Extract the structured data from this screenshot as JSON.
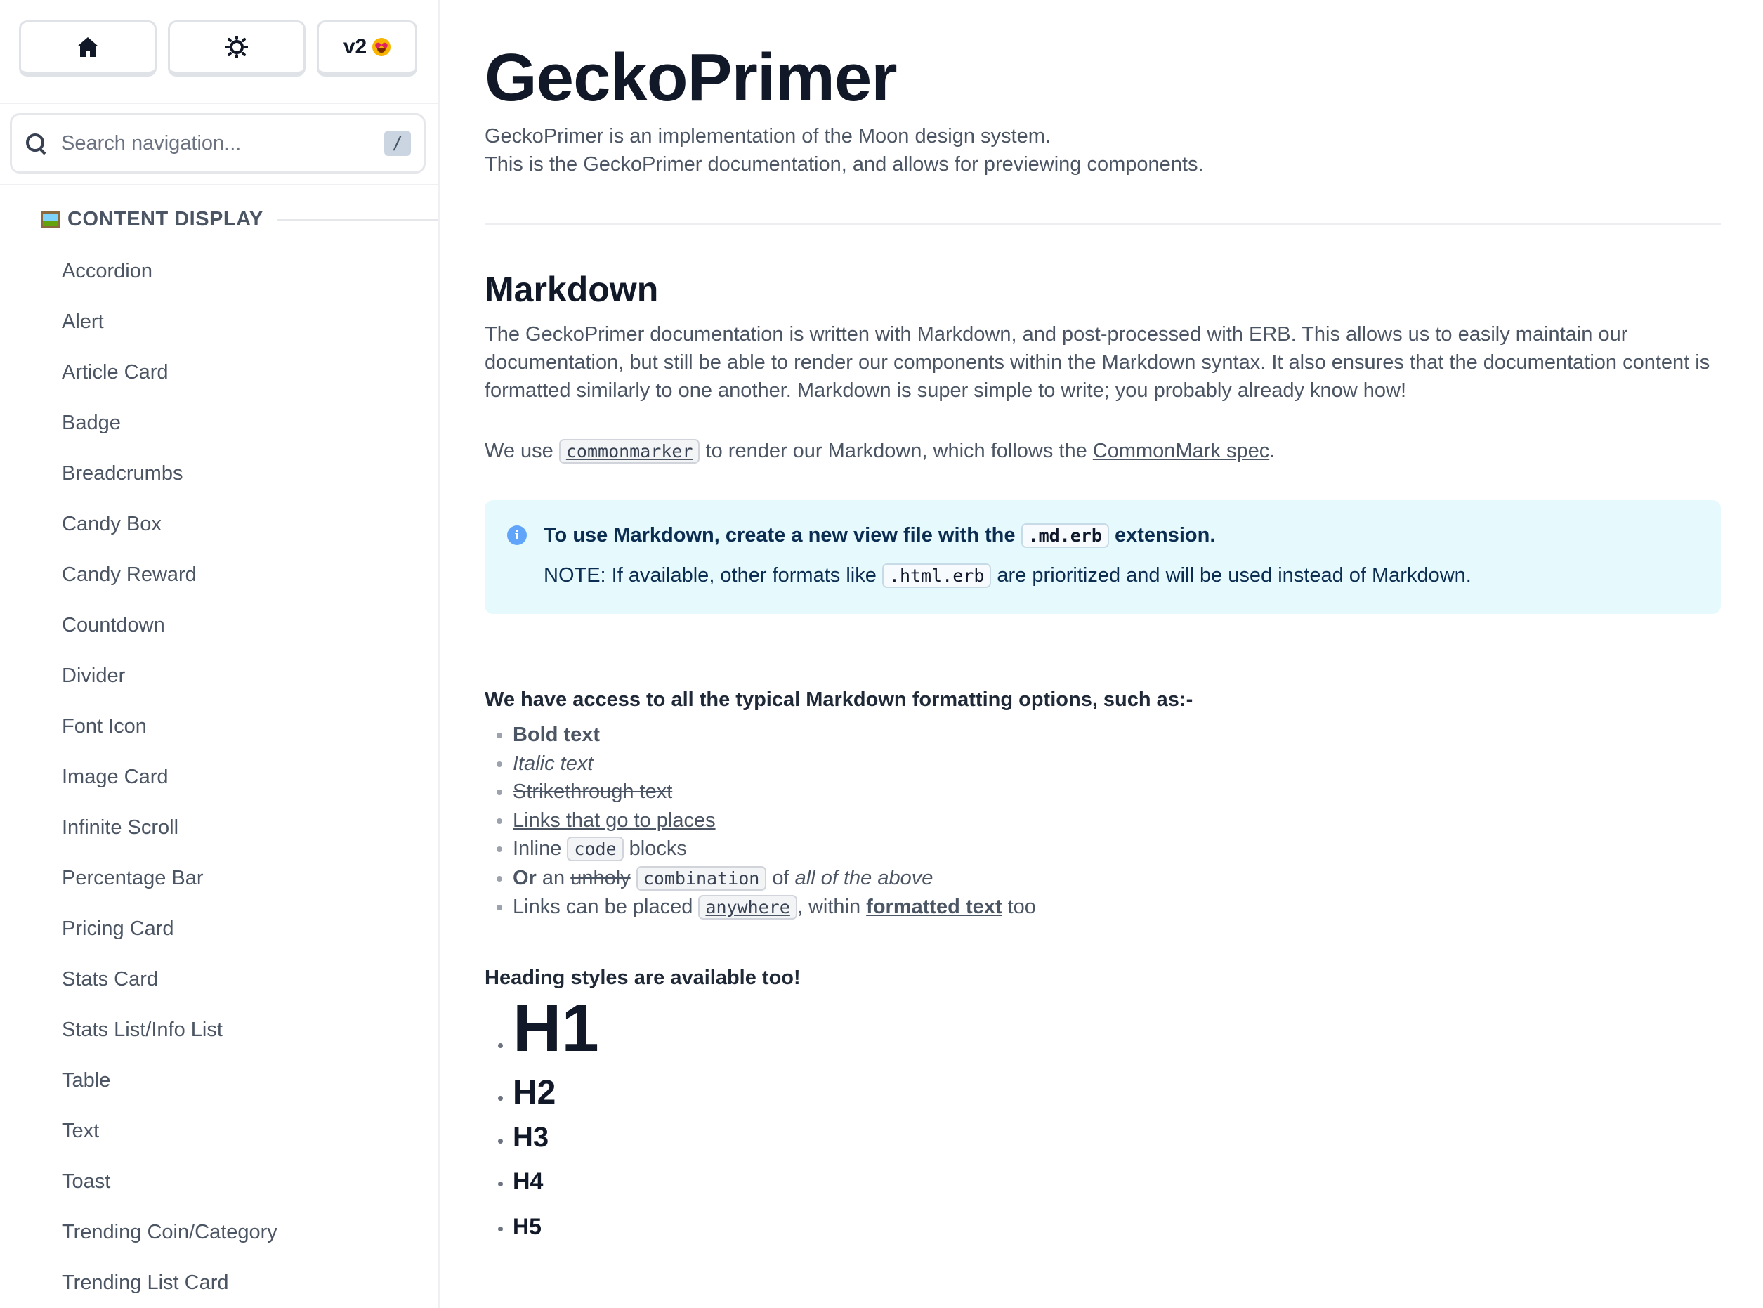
{
  "toolbar": {
    "home_label": "home",
    "theme_label": "toggle theme",
    "version_label": "v2"
  },
  "search": {
    "placeholder": "Search navigation...",
    "shortcut": "/"
  },
  "sidebar": {
    "section": "CONTENT DISPLAY",
    "items": [
      "Accordion",
      "Alert",
      "Article Card",
      "Badge",
      "Breadcrumbs",
      "Candy Box",
      "Candy Reward",
      "Countdown",
      "Divider",
      "Font Icon",
      "Image Card",
      "Infinite Scroll",
      "Percentage Bar",
      "Pricing Card",
      "Stats Card",
      "Stats List/Info List",
      "Table",
      "Text",
      "Toast",
      "Trending Coin/Category",
      "Trending List Card"
    ]
  },
  "page": {
    "title": "GeckoPrimer",
    "lead_line1": "GeckoPrimer is an implementation of the Moon design system.",
    "lead_line2": "This is the GeckoPrimer documentation, and allows for previewing components."
  },
  "markdown": {
    "heading": "Markdown",
    "para1": "The GeckoPrimer documentation is written with Markdown, and post-processed with ERB. This allows us to easily maintain our documentation, but still be able to render our components within the Markdown syntax. It also ensures that the documentation content is formatted similarly to one another. Markdown is super simple to write; you probably already know how!",
    "para2_before": "We use ",
    "para2_code": "commonmarker",
    "para2_middle": " to render our Markdown, which follows the ",
    "para2_link": "CommonMark spec",
    "para2_after": "."
  },
  "info": {
    "icon": "info-icon",
    "title_before": "To use Markdown, create a new view file with the ",
    "title_code": ".md.erb",
    "title_after": " extension.",
    "note_before": "NOTE: If available, other formats like ",
    "note_code": ".html.erb",
    "note_after": " are prioritized and will be used instead of Markdown."
  },
  "formatting": {
    "intro": "We have access to all the typical Markdown formatting options, such as:-",
    "bold": "Bold text",
    "italic": "Italic text",
    "strike": "Strikethrough text",
    "link": "Links that go to places",
    "inline_before": "Inline ",
    "inline_code": "code",
    "inline_after": " blocks",
    "combo_or": "Or",
    "combo_an": " an ",
    "combo_unholy": "unholy",
    "combo_code": "combination",
    "combo_of": " of ",
    "combo_italic": "all of the above",
    "links_before": "Links can be placed ",
    "links_code": "anywhere",
    "links_middle": ", within ",
    "links_formatted": "formatted text",
    "links_after": " too"
  },
  "headings": {
    "intro": "Heading styles are available too!",
    "h1": "H1",
    "h2": "H2",
    "h3": "H3",
    "h4": "H4",
    "h5": "H5"
  }
}
